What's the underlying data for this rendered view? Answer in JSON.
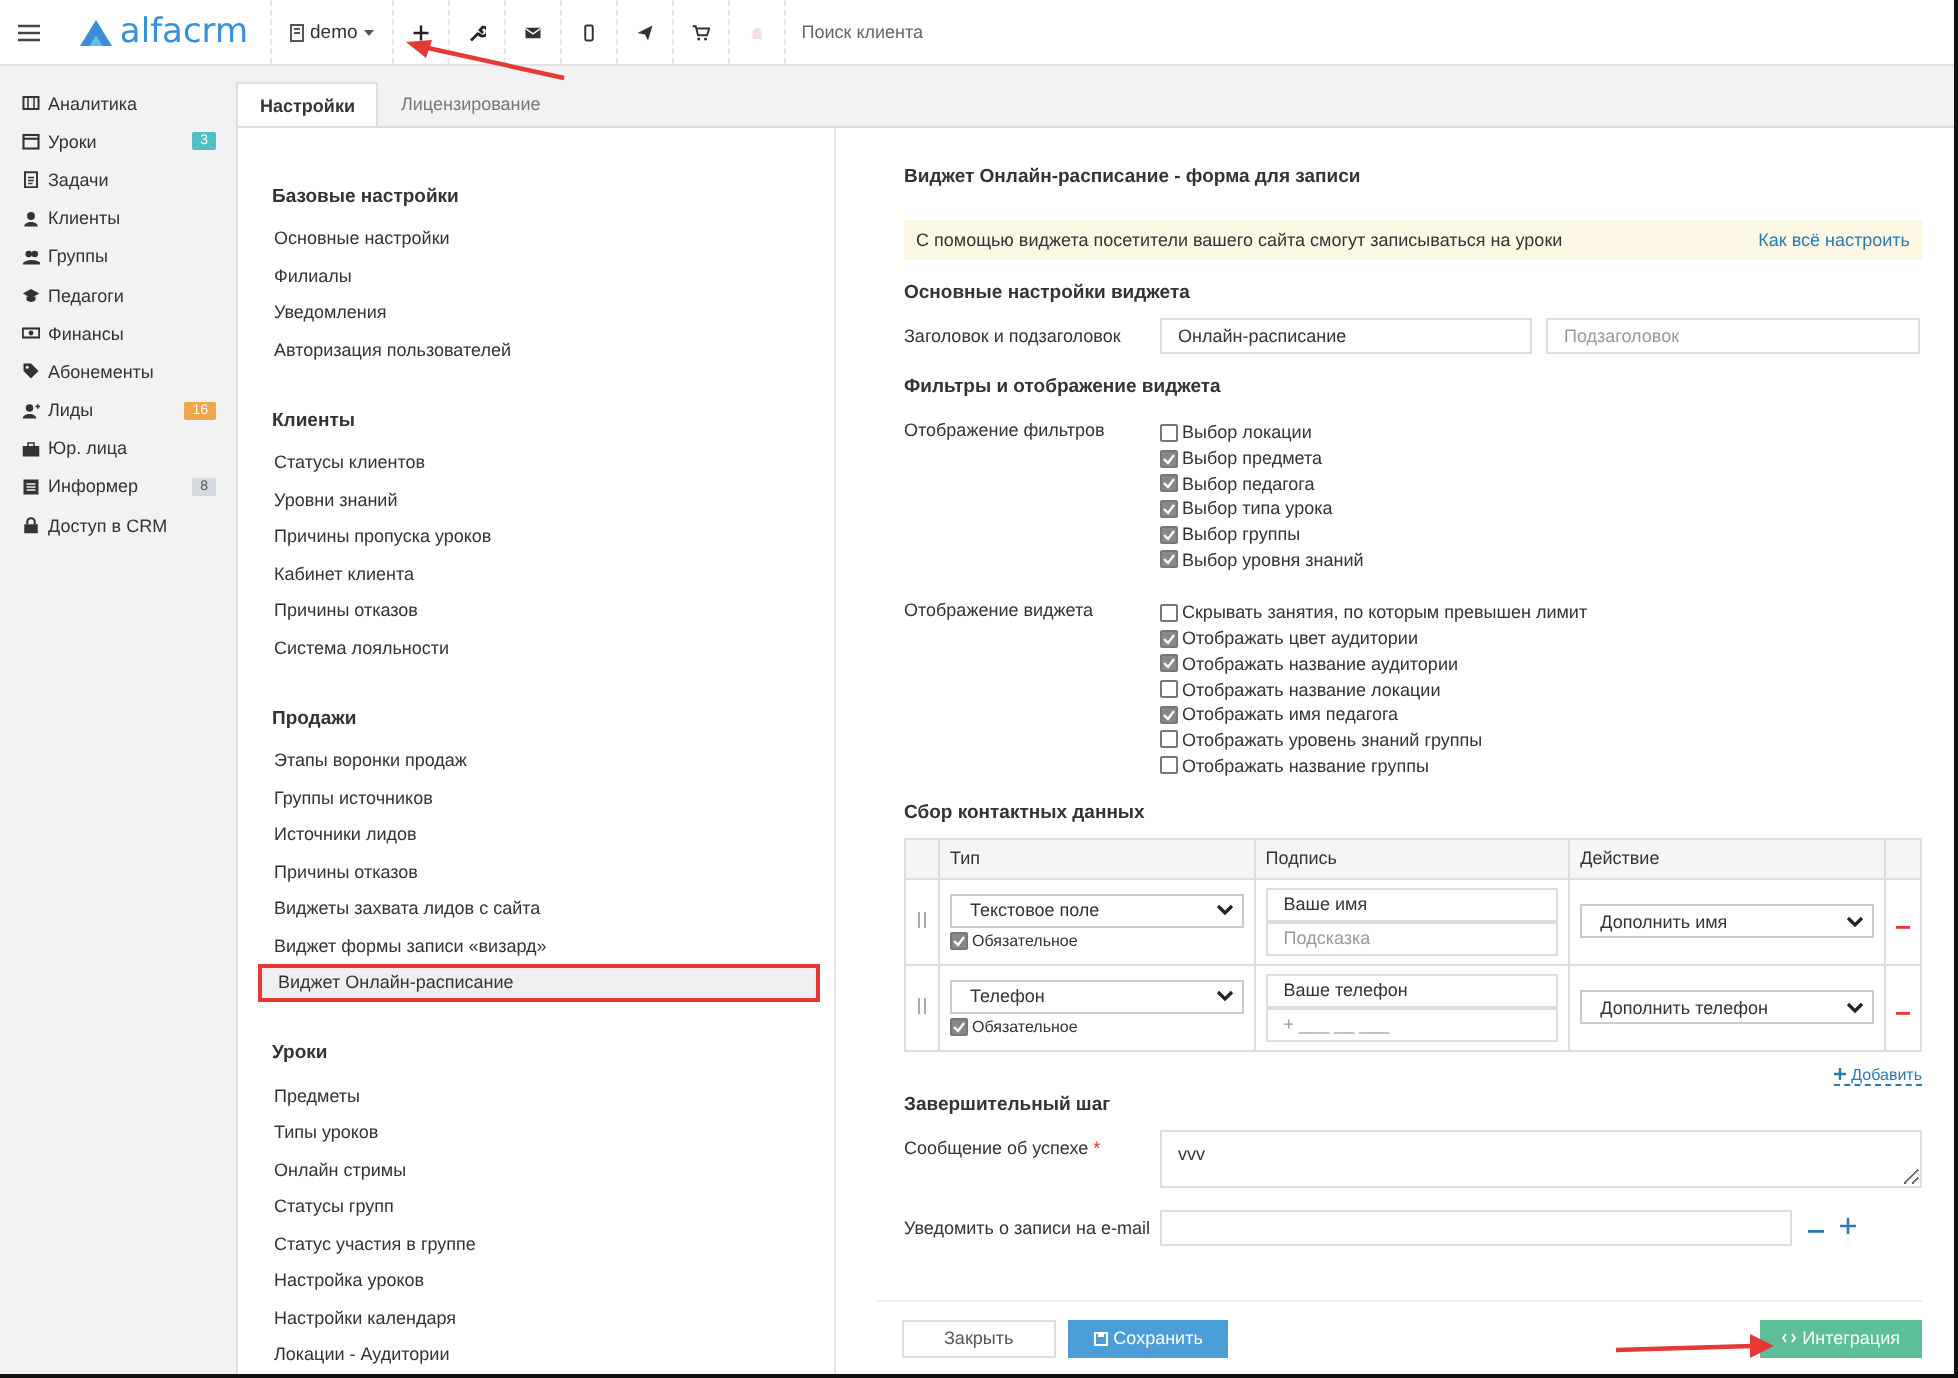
{
  "topbar": {
    "brand": "alfacrm",
    "branch": "demo",
    "search": {
      "placeholder": "Поиск клиента"
    }
  },
  "sidebar": {
    "items": [
      {
        "label": "Аналитика"
      },
      {
        "label": "Уроки",
        "badge": "3",
        "color": "#4fc1c2"
      },
      {
        "label": "Задачи"
      },
      {
        "label": "Клиенты"
      },
      {
        "label": "Группы"
      },
      {
        "label": "Педагоги"
      },
      {
        "label": "Финансы"
      },
      {
        "label": "Абонементы"
      },
      {
        "label": "Лиды",
        "badge": "16",
        "color": "#f0a54a"
      },
      {
        "label": "Юр. лица"
      },
      {
        "label": "Информер",
        "badge": "8",
        "color": "#d5dbe0"
      },
      {
        "label": "Доступ в CRM"
      }
    ]
  },
  "tabs": [
    {
      "label": "Настройки",
      "selected": true
    },
    {
      "label": "Лицензирование",
      "selected": false
    }
  ],
  "settings_menu": [
    {
      "title": "Базовые настройки",
      "items": [
        {
          "label": "Основные настройки",
          "selected": false
        },
        {
          "label": "Филиалы",
          "selected": false
        },
        {
          "label": "Уведомления",
          "selected": false
        },
        {
          "label": "Авторизация пользователей",
          "selected": false
        }
      ]
    },
    {
      "title": "Клиенты",
      "items": [
        {
          "label": "Статусы клиентов",
          "selected": false
        },
        {
          "label": "Уровни знаний",
          "selected": false
        },
        {
          "label": "Причины пропуска уроков",
          "selected": false
        },
        {
          "label": "Кабинет клиента",
          "selected": false
        },
        {
          "label": "Причины отказов",
          "selected": false
        },
        {
          "label": "Система лояльности",
          "selected": false
        }
      ]
    },
    {
      "title": "Продажи",
      "items": [
        {
          "label": "Этапы воронки продаж",
          "selected": false
        },
        {
          "label": "Группы источников",
          "selected": false
        },
        {
          "label": "Источники лидов",
          "selected": false
        },
        {
          "label": "Причины отказов",
          "selected": false
        },
        {
          "label": "Виджеты захвата лидов с сайта",
          "selected": false
        },
        {
          "label": "Виджет формы записи «визард»",
          "selected": false
        },
        {
          "label": "Виджет Онлайн-расписание",
          "selected": true
        }
      ]
    },
    {
      "title": "Уроки",
      "items": [
        {
          "label": "Предметы",
          "selected": false
        },
        {
          "label": "Типы уроков",
          "selected": false
        },
        {
          "label": "Онлайн стримы",
          "selected": false
        },
        {
          "label": "Статусы групп",
          "selected": false
        },
        {
          "label": "Статус участия в группе",
          "selected": false
        },
        {
          "label": "Настройка уроков",
          "selected": false
        },
        {
          "label": "Настройки календаря",
          "selected": false
        },
        {
          "label": "Локации - Аудитории",
          "selected": false
        }
      ]
    }
  ],
  "form": {
    "title": "Виджет Онлайн-расписание - форма для записи",
    "notice": {
      "text": "С помощью виджета посетители вашего сайта смогут записываться на уроки",
      "link": "Как всё настроить"
    },
    "basic": {
      "title": "Основные настройки виджета",
      "label": "Заголовок и подзаголовок",
      "heading_value": "Онлайн-расписание",
      "subheading_placeholder": "Подзаголовок"
    },
    "display": {
      "title": "Фильтры и отображение виджета",
      "groups": [
        {
          "label": "Отображение фильтров",
          "options": [
            {
              "label": "Выбор локации",
              "checked": false
            },
            {
              "label": "Выбор предмета",
              "checked": true
            },
            {
              "label": "Выбор педагога",
              "checked": true
            },
            {
              "label": "Выбор типа урока",
              "checked": true
            },
            {
              "label": "Выбор группы",
              "checked": true
            },
            {
              "label": "Выбор уровня знаний",
              "checked": true
            }
          ]
        },
        {
          "label": "Отображение виджета",
          "options": [
            {
              "label": "Скрывать занятия, по которым превышен лимит",
              "checked": false
            },
            {
              "label": "Отображать цвет аудитории",
              "checked": true
            },
            {
              "label": "Отображать название аудитории",
              "checked": true
            },
            {
              "label": "Отображать название локации",
              "checked": false
            },
            {
              "label": "Отображать имя педагога",
              "checked": true
            },
            {
              "label": "Отображать уровень знаний группы",
              "checked": false
            },
            {
              "label": "Отображать название группы",
              "checked": false
            }
          ]
        }
      ]
    },
    "contacts": {
      "title": "Сбор контактных данных",
      "columns": [
        "Тип",
        "Подпись",
        "Действие"
      ],
      "rows": [
        {
          "type": "Текстовое поле",
          "required": true,
          "required_label": "Обязательное",
          "caption": "Ваше имя",
          "hint_placeholder": "Подсказка",
          "action": "Дополнить имя"
        },
        {
          "type": "Телефон",
          "required": true,
          "required_label": "Обязательное",
          "caption": "Ваше телефон",
          "hint_placeholder": "+ ___ __ ___",
          "action": "Дополнить телефон"
        }
      ],
      "add_link": "Добавить"
    },
    "final": {
      "title": "Завершительный шаг",
      "success_label": "Сообщение об успехе",
      "success_required_mark": "*",
      "success_value": "vvv",
      "email_label": "Уведомить о записи на e-mail"
    },
    "buttons": {
      "close": "Закрыть",
      "save": "Сохранить",
      "integration": "Интеграция"
    }
  }
}
